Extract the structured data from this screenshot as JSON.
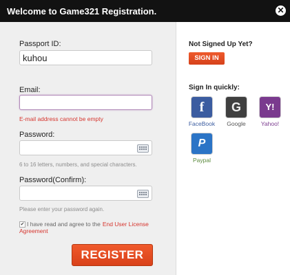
{
  "window": {
    "title": "Welcome to Game321 Registration.",
    "close_icon": "close-icon"
  },
  "form": {
    "passport_label": "Passport ID:",
    "passport_value": "kuhou",
    "email_label": "Email:",
    "email_value": "",
    "email_error": "E-mail address cannot be empty",
    "password_label": "Password:",
    "password_hint": "6 to 16 letters, numbers, and special characters.",
    "confirm_label": "Password(Confirm):",
    "confirm_hint": "Please enter your password again.",
    "agree_text": "I have read and agree to the",
    "agree_checked": true,
    "eula_link": "End User License Agreement",
    "register_label": "REGISTER"
  },
  "sidebar": {
    "not_signed_up": "Not Signed Up Yet?",
    "sign_in_button": "SIGN IN",
    "sign_in_quickly": "Sign In quickly:",
    "providers": [
      {
        "name": "FaceBook",
        "glyph": "f",
        "color": "#3b5ca0",
        "caption_color": "#3b5ca0"
      },
      {
        "name": "Google",
        "glyph": "G",
        "color": "#3f3f3f",
        "caption_color": "#555555"
      },
      {
        "name": "Yahoo!",
        "glyph": "Y!",
        "color": "#7a3a8e",
        "caption_color": "#7a3a8e"
      },
      {
        "name": "Paypal",
        "glyph": "P",
        "color": "#2b74c6",
        "caption_color": "#5a8a3c"
      }
    ]
  },
  "colors": {
    "accent": "#e8502a",
    "error": "#d6352e",
    "titlebar": "#121212"
  }
}
